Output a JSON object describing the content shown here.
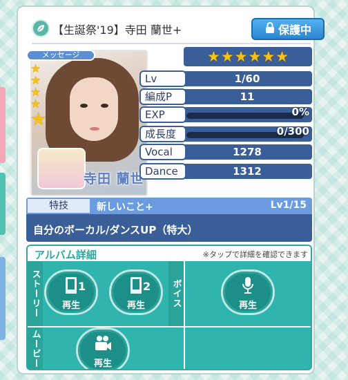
{
  "header": {
    "title": "【生誕祭'19】寺田 蘭世+",
    "protect_label": "保護中"
  },
  "card": {
    "message_label": "メッセージ",
    "signature": "寺田 蘭世",
    "rarity_stars": 6
  },
  "stats": [
    {
      "label": "Lv",
      "value": "1/60",
      "type": "text"
    },
    {
      "label": "編成P",
      "value": "11",
      "type": "text"
    },
    {
      "label": "EXP",
      "value": "0%",
      "type": "bar",
      "progress": 0
    },
    {
      "label": "成長度",
      "value": "0/300",
      "type": "bar",
      "progress": 0
    },
    {
      "label": "Vocal",
      "value": "1278",
      "type": "text"
    },
    {
      "label": "Dance",
      "value": "1312",
      "type": "text"
    }
  ],
  "skill": {
    "label": "特技",
    "name": "新しいこと+",
    "level": "Lv1/15",
    "description": "自分のボーカル/ダンスUP（特大）"
  },
  "album": {
    "title": "アルバム詳細",
    "note": "※タップで詳細を確認できます",
    "story_label": "ストーリー",
    "voice_label": "ボイス",
    "movie_label": "ムービー",
    "play_label": "再生",
    "story_1_num": "1",
    "story_2_num": "2"
  },
  "colors": {
    "accent_blue": "#3a5f98",
    "teal": "#2fb5ad",
    "star": "#f7c21a"
  }
}
